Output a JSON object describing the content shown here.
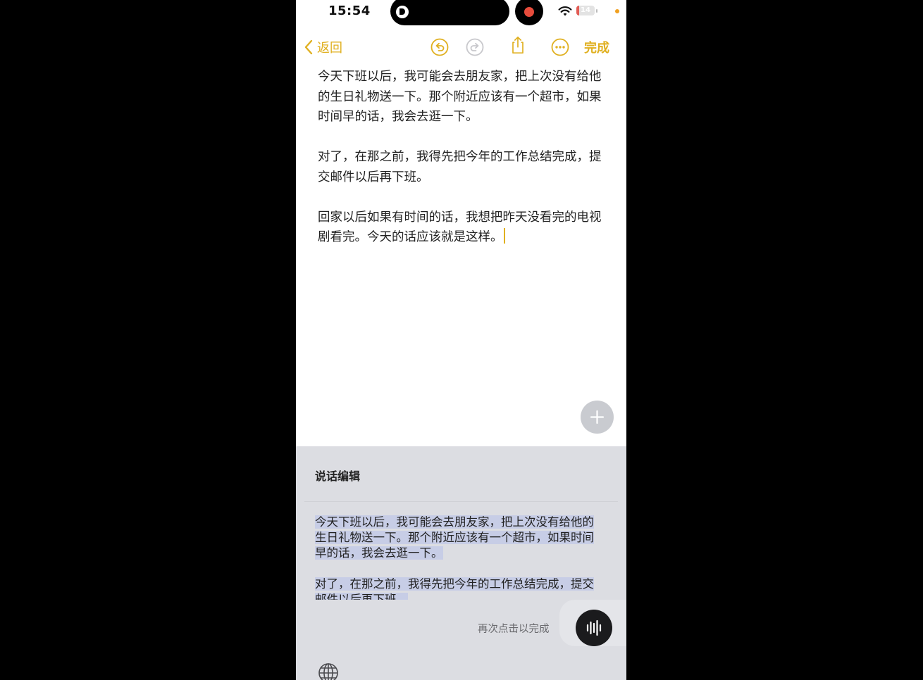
{
  "status_bar": {
    "time": "15:54",
    "battery_level": "14",
    "battery_fraction": 0.14,
    "recording_color": "#e74c3c"
  },
  "nav": {
    "back_label": "返回",
    "done_label": "完成",
    "accent_color": "#e0b020",
    "icons": [
      "chevron-left-icon",
      "undo-icon",
      "redo-icon",
      "share-icon",
      "more-icon"
    ]
  },
  "note": {
    "paragraphs": [
      "今天下班以后，我可能会去朋友家，把上次没有给他的生日礼物送一下。那个附近应该有一个超市，如果时间早的话，我会去逛一下。",
      "对了，在那之前，我得先把今年的工作总结完成，提交邮件以后再下班。",
      "回家以后如果有时间的话，我想把昨天没看完的电视剧看完。今天的话应该就是这样。"
    ]
  },
  "dictation": {
    "title": "说话编辑",
    "transcript": [
      "今天下班以后，我可能会去朋友家，把上次没有给他的生日礼物送一下。那个附近应该有一个超市，如果时间早的话，我会去逛一下。",
      "对了，在那之前，我得先把今年的工作总结完成，提交邮件以后再下班。"
    ],
    "hint": "再次点击以完成",
    "highlight_color": "#c7cde6"
  }
}
